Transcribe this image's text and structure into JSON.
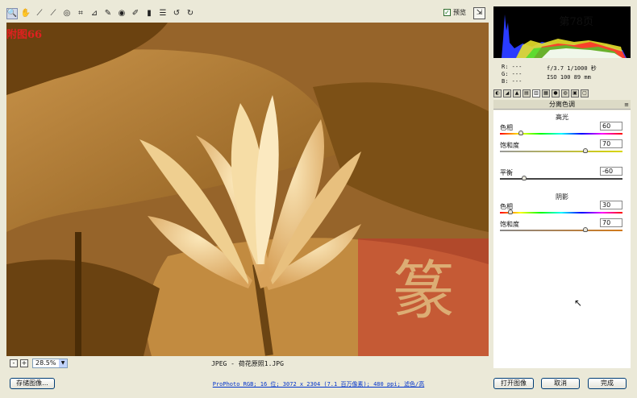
{
  "toolbar": {
    "tools": [
      {
        "name": "zoom-tool",
        "glyph": "🔍"
      },
      {
        "name": "hand-tool",
        "glyph": "✋"
      },
      {
        "name": "white-balance-tool",
        "glyph": "⟋"
      },
      {
        "name": "color-sampler-tool",
        "glyph": "⟋"
      },
      {
        "name": "target-adjust-tool",
        "glyph": "◎"
      },
      {
        "name": "crop-tool",
        "glyph": "⌗"
      },
      {
        "name": "straighten-tool",
        "glyph": "⊿"
      },
      {
        "name": "spot-removal-tool",
        "glyph": "✎"
      },
      {
        "name": "red-eye-tool",
        "glyph": "◉"
      },
      {
        "name": "adjustment-brush-tool",
        "glyph": "✐"
      },
      {
        "name": "graduated-filter-tool",
        "glyph": "▮"
      },
      {
        "name": "preferences-tool",
        "glyph": "☰"
      },
      {
        "name": "rotate-ccw-tool",
        "glyph": "↺"
      },
      {
        "name": "rotate-cw-tool",
        "glyph": "↻"
      }
    ],
    "preview_label": "预览",
    "preview_checked": "✓",
    "fullscreen_glyph": "⇲"
  },
  "overlay": {
    "figure_label": "附图66",
    "page_number": "第78页"
  },
  "image_status": {
    "zoom_out": "-",
    "zoom_in": "+",
    "zoom_value": "28.5%",
    "filename": "JPEG - 荷花原照1.JPG"
  },
  "meta": {
    "r": "R:  ---",
    "g": "G:  ---",
    "b": "B:  ---",
    "exposure": "f/3.7  1/1000 秒",
    "iso": "ISO 100  89 mm"
  },
  "panel": {
    "title": "分离色调",
    "menu_glyph": "≡",
    "highlights_title": "高光",
    "highlights_hue_label": "色相",
    "highlights_hue_value": "60",
    "highlights_sat_label": "饱和度",
    "highlights_sat_value": "70",
    "balance_label": "平衡",
    "balance_value": "-60",
    "shadows_title": "阴影",
    "shadows_hue_label": "色相",
    "shadows_hue_value": "30",
    "shadows_sat_label": "饱和度",
    "shadows_sat_value": "70"
  },
  "bottom": {
    "save_label": "存储图像...",
    "workflow_link": "ProPhoto RGB; 16 位; 3072 x 2304 (7.1 百万像素); 480 ppi; 滤色/高",
    "open_label": "打开图像",
    "cancel_label": "取消",
    "done_label": "完成"
  },
  "colors": {
    "figure_label": "#e02020",
    "stamp": "#c8332d",
    "sepia_mid": "#b88436"
  }
}
